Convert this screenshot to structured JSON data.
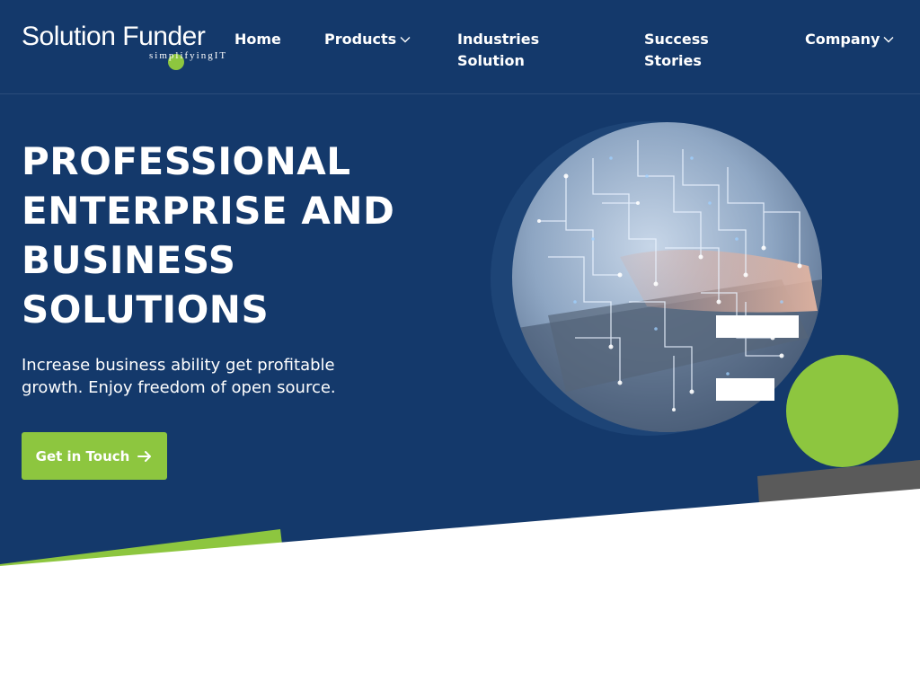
{
  "brand": {
    "name_part1": "Solution F",
    "name_part2": "under",
    "tagline": "simplifyingIT"
  },
  "nav": {
    "items": [
      {
        "label": "Home",
        "has_dropdown": false
      },
      {
        "label": "Products",
        "has_dropdown": true
      },
      {
        "label": "Industries Solution",
        "has_dropdown": false
      },
      {
        "label": "Success Stories",
        "has_dropdown": false
      },
      {
        "label": "Company",
        "has_dropdown": true
      }
    ]
  },
  "hero": {
    "headline": "PROFESSIONAL ENTERPRISE AND BUSINESS SOLUTIONS",
    "subtext": "Increase business ability get profitable growth. Enjoy freedom of open source.",
    "cta_label": "Get in Touch",
    "cta_icon": "arrow-right-icon",
    "image_icon": "circuit-globe-image"
  },
  "colors": {
    "primary": "#14396b",
    "accent": "#8dc63f",
    "dark_shape": "#5a5a5a",
    "text": "#ffffff"
  }
}
